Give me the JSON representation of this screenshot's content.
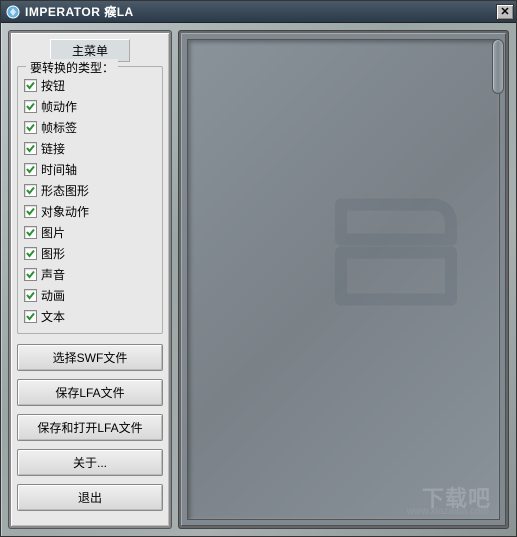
{
  "window": {
    "title": "IMPERATOR 瘊LA",
    "close": "✕"
  },
  "sidebar": {
    "menu_header": "主菜单",
    "group_title": "要转换的类型：",
    "items": [
      {
        "label": "按钮",
        "checked": true
      },
      {
        "label": "帧动作",
        "checked": true
      },
      {
        "label": "帧标签",
        "checked": true
      },
      {
        "label": "链接",
        "checked": true
      },
      {
        "label": "时间轴",
        "checked": true
      },
      {
        "label": "形态图形",
        "checked": true
      },
      {
        "label": "对象动作",
        "checked": true
      },
      {
        "label": "图片",
        "checked": true
      },
      {
        "label": "图形",
        "checked": true
      },
      {
        "label": "声音",
        "checked": true
      },
      {
        "label": "动画",
        "checked": true
      },
      {
        "label": "文本",
        "checked": true
      }
    ],
    "buttons": {
      "select_swf": "选择SWF文件",
      "save_lfa": "保存LFA文件",
      "save_open_lfa": "保存和打开LFA文件",
      "about": "关于...",
      "exit": "退出"
    }
  },
  "preview": {
    "watermark": "下载吧",
    "watermark_url": "www.xiazaiba.com"
  },
  "colors": {
    "titlebar": "#3a4a58",
    "panel_bg": "#e8e8e8",
    "preview_bg": "#808890",
    "check": "#2a9030"
  }
}
